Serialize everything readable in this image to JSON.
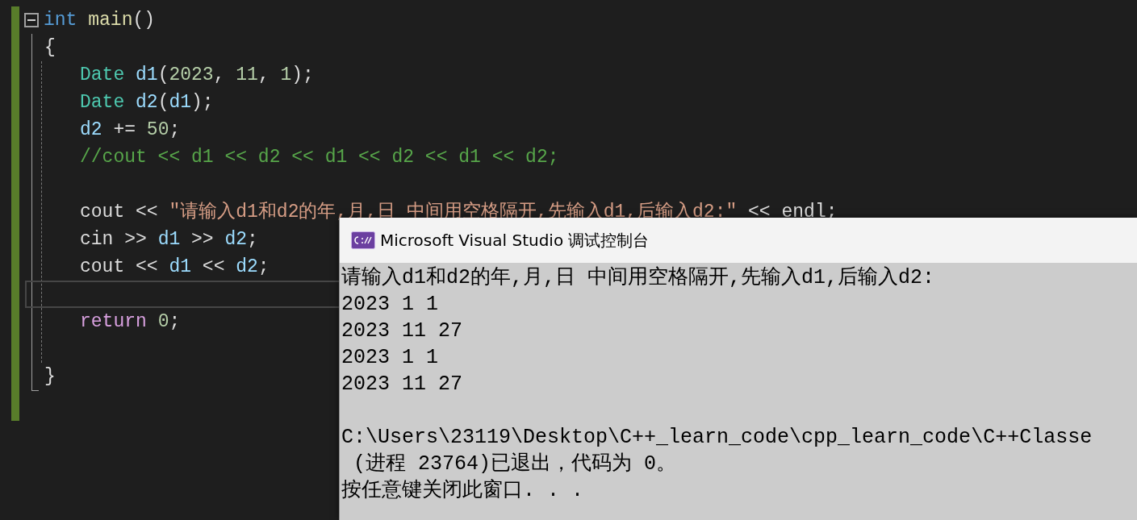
{
  "editor": {
    "function": {
      "signature": [
        {
          "kind": "keyword",
          "text": "int "
        },
        {
          "kind": "function",
          "text": "main"
        },
        {
          "kind": "plain",
          "text": "()"
        }
      ],
      "open_brace": "{",
      "body": [
        {
          "kind": "code",
          "current": false,
          "tokens": [
            {
              "kind": "type",
              "text": "Date "
            },
            {
              "kind": "variable",
              "text": "d1"
            },
            {
              "kind": "plain",
              "text": "("
            },
            {
              "kind": "number",
              "text": "2023"
            },
            {
              "kind": "plain",
              "text": ", "
            },
            {
              "kind": "number",
              "text": "11"
            },
            {
              "kind": "plain",
              "text": ", "
            },
            {
              "kind": "number",
              "text": "1"
            },
            {
              "kind": "plain",
              "text": ");"
            }
          ]
        },
        {
          "kind": "code",
          "current": false,
          "tokens": [
            {
              "kind": "type",
              "text": "Date "
            },
            {
              "kind": "variable",
              "text": "d2"
            },
            {
              "kind": "plain",
              "text": "("
            },
            {
              "kind": "variable",
              "text": "d1"
            },
            {
              "kind": "plain",
              "text": ");"
            }
          ]
        },
        {
          "kind": "code",
          "current": false,
          "tokens": [
            {
              "kind": "variable",
              "text": "d2"
            },
            {
              "kind": "plain",
              "text": " += "
            },
            {
              "kind": "number",
              "text": "50"
            },
            {
              "kind": "plain",
              "text": ";"
            }
          ]
        },
        {
          "kind": "code",
          "current": false,
          "tokens": [
            {
              "kind": "comment",
              "text": "//cout << d1 << d2 << d1 << d2 << d1 << d2;"
            }
          ]
        },
        {
          "kind": "blank",
          "current": false
        },
        {
          "kind": "code",
          "current": false,
          "tokens": [
            {
              "kind": "plain",
              "text": "cout << "
            },
            {
              "kind": "string",
              "text": "\"请输入d1和d2的年,月,日 中间用空格隔开,先输入d1,后输入d2:\""
            },
            {
              "kind": "plain",
              "text": " << endl;"
            }
          ]
        },
        {
          "kind": "code",
          "current": false,
          "tokens": [
            {
              "kind": "plain",
              "text": "cin >> "
            },
            {
              "kind": "variable",
              "text": "d1"
            },
            {
              "kind": "plain",
              "text": " >> "
            },
            {
              "kind": "variable",
              "text": "d2"
            },
            {
              "kind": "plain",
              "text": ";"
            }
          ]
        },
        {
          "kind": "code",
          "current": false,
          "tokens": [
            {
              "kind": "plain",
              "text": "cout << "
            },
            {
              "kind": "variable",
              "text": "d1"
            },
            {
              "kind": "plain",
              "text": " << "
            },
            {
              "kind": "variable",
              "text": "d2"
            },
            {
              "kind": "plain",
              "text": ";"
            }
          ]
        },
        {
          "kind": "blank",
          "current": true
        },
        {
          "kind": "code",
          "current": false,
          "tokens": [
            {
              "kind": "control",
              "text": "return "
            },
            {
              "kind": "number",
              "text": "0"
            },
            {
              "kind": "plain",
              "text": ";"
            }
          ]
        },
        {
          "kind": "blank",
          "current": false
        }
      ],
      "close_brace": "}"
    }
  },
  "console": {
    "title": "Microsoft Visual Studio 调试控制台",
    "output_blocks": [
      [
        "请输入d1和d2的年,月,日 中间用空格隔开,先输入d1,后输入d2:",
        "2023 1 1",
        "2023 11 27",
        "2023 1 1",
        "2023 11 27"
      ],
      [
        "C:\\Users\\23119\\Desktop\\C++_learn_code\\cpp_learn_code\\C++Classe",
        " (进程 23764)已退出，代码为 0。",
        "按任意键关闭此窗口. . ."
      ]
    ]
  }
}
